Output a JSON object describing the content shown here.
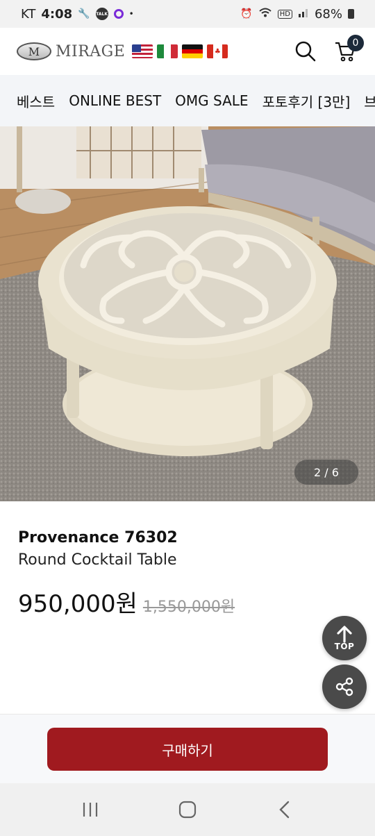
{
  "status_bar": {
    "carrier": "KT",
    "time": "4:08",
    "battery": "68%"
  },
  "header": {
    "logo_text": "MIRAGE",
    "logo_mark": "M",
    "flags": [
      "us-flag",
      "italy-flag",
      "germany-flag",
      "canada-flag"
    ],
    "cart_count": "0"
  },
  "nav": {
    "items": [
      "베스트",
      "ONLINE BEST",
      "OMG SALE",
      "포토후기 [3만]",
      "브"
    ]
  },
  "gallery": {
    "counter": "2 / 6",
    "current": 2,
    "total": 6
  },
  "product": {
    "title": "Provenance 76302",
    "subtitle": "Round Cocktail Table",
    "price": "950,000원",
    "original_price": "1,550,000원"
  },
  "fab": {
    "top_label": "TOP"
  },
  "buy": {
    "label": "구매하기",
    "color": "#a01a1f"
  }
}
